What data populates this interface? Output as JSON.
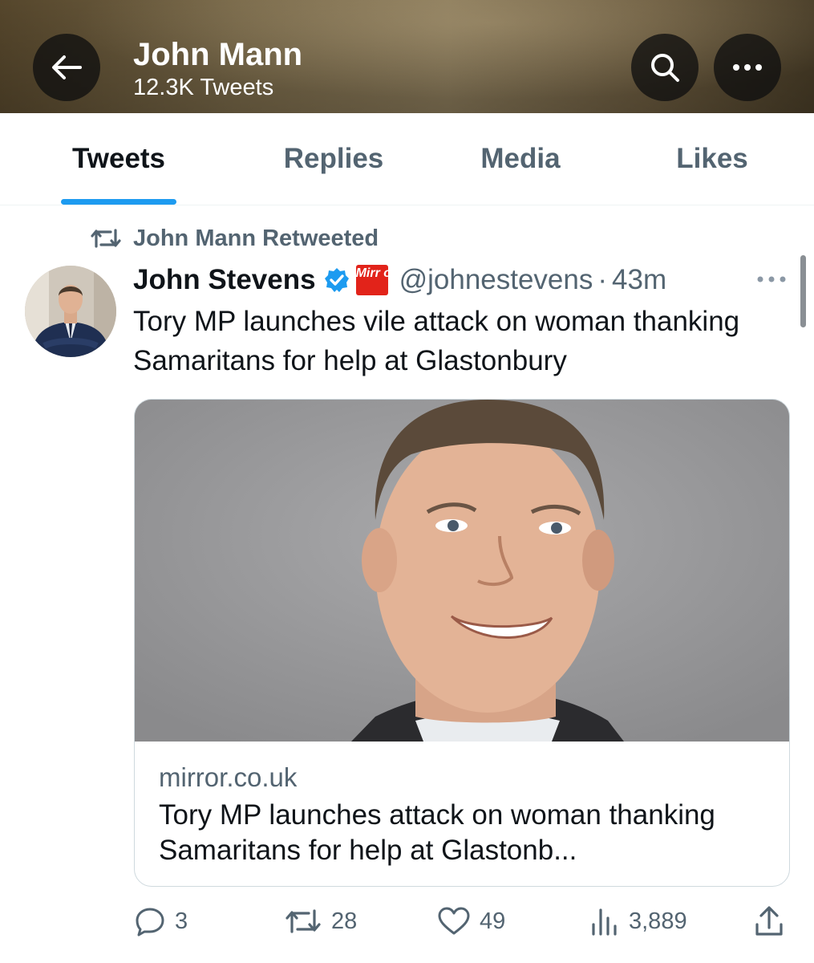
{
  "header": {
    "title": "John Mann",
    "subtitle": "12.3K Tweets",
    "icons": [
      "arrow-left-icon",
      "search-icon",
      "more-horizontal-icon"
    ]
  },
  "tabs": [
    {
      "label": "Tweets",
      "active": true
    },
    {
      "label": "Replies",
      "active": false
    },
    {
      "label": "Media",
      "active": false
    },
    {
      "label": "Likes",
      "active": false
    }
  ],
  "tweet": {
    "retweeted_by": "John Mann Retweeted",
    "author": {
      "name": "John Stevens",
      "verified": true,
      "affiliation_badge": "Mirr or",
      "handle": "@johnestevens",
      "separator": "·",
      "time": "43m"
    },
    "text": "Tory MP launches vile attack on woman thanking Samaritans for help at Glastonbury",
    "card": {
      "domain": "mirror.co.uk",
      "title": "Tory MP launches attack on woman thanking Samaritans for help at Glastonb..."
    },
    "actions": {
      "replies": "3",
      "retweets": "28",
      "likes": "49",
      "views": "3,889"
    }
  },
  "colors": {
    "accent": "#1d9bf0",
    "secondary_text": "#536471",
    "primary_text": "#0f1419",
    "mirror_red": "#e2231a"
  }
}
